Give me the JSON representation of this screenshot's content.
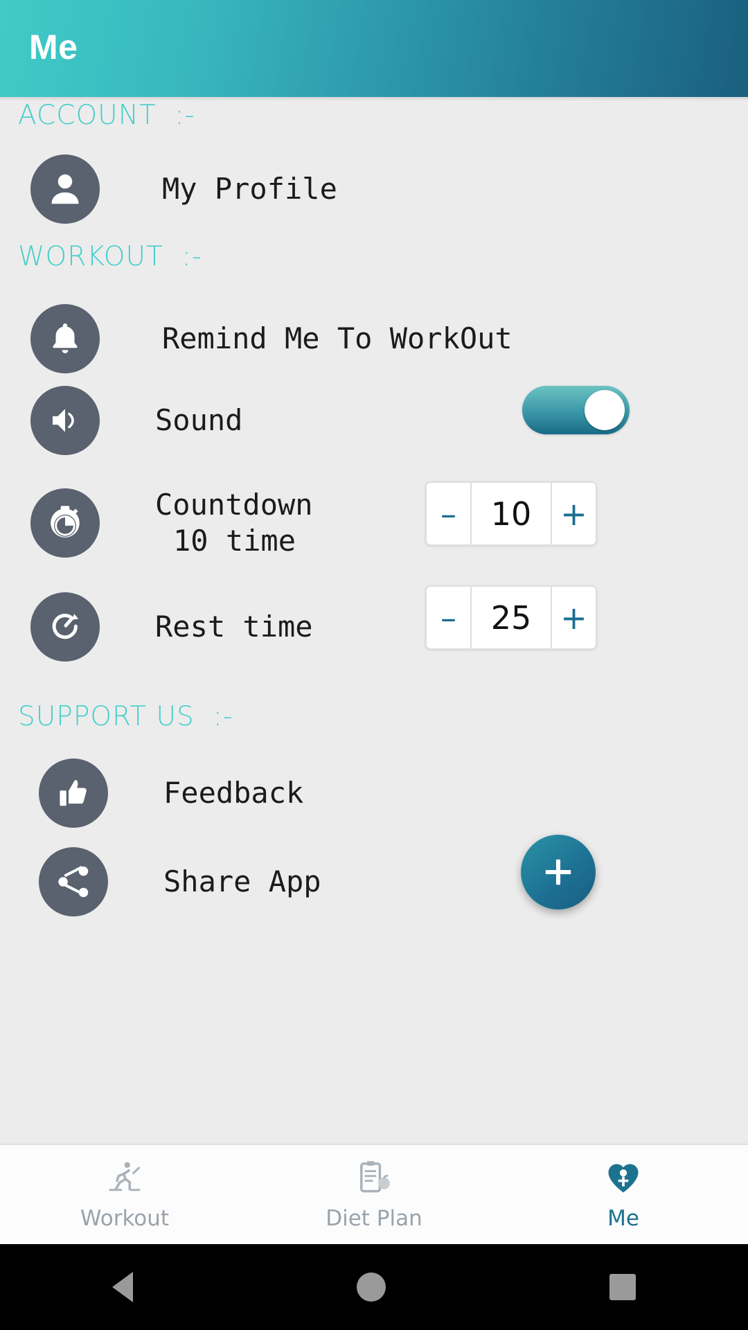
{
  "header": {
    "title": "Me"
  },
  "sections": {
    "account": {
      "title": "ACCOUNT  :-"
    },
    "workout": {
      "title": "WORKOUT  :-"
    },
    "support": {
      "title": "SUPPORT US  :-"
    }
  },
  "rows": {
    "profile": {
      "label": "My Profile",
      "icon": "person-icon"
    },
    "remind": {
      "label": "Remind Me To WorkOut",
      "icon": "bell-icon"
    },
    "sound": {
      "label": "Sound",
      "icon": "speaker-icon",
      "toggle_on": true
    },
    "countdown": {
      "label_line1": "Countdown",
      "label_line2": "10 time",
      "icon": "stopwatch-icon",
      "value": "10",
      "minus": "–",
      "plus": "+"
    },
    "rest": {
      "label": "Rest time",
      "icon": "refresh-icon",
      "value": "25",
      "minus": "–",
      "plus": "+"
    },
    "feedback": {
      "label": "Feedback",
      "icon": "thumbs-up-icon"
    },
    "share": {
      "label": "Share App",
      "icon": "share-icon"
    }
  },
  "fab": {
    "label": "+",
    "icon": "plus-icon"
  },
  "bottom_nav": {
    "items": [
      {
        "label": "Workout",
        "icon": "running-icon",
        "active": false
      },
      {
        "label": "Diet Plan",
        "icon": "clipboard-icon",
        "active": false
      },
      {
        "label": "Me",
        "icon": "heart-person-icon",
        "active": true
      }
    ]
  },
  "system_nav": {
    "back": "back-triangle-icon",
    "home": "home-circle-icon",
    "recents": "recents-square-icon"
  },
  "colors": {
    "accent_light": "#44cfcb",
    "accent_dark": "#1a5f7e",
    "icon_circle": "#59626e",
    "background": "#ececec",
    "nav_active": "#1c7390",
    "nav_inactive": "#9aa3ab"
  }
}
